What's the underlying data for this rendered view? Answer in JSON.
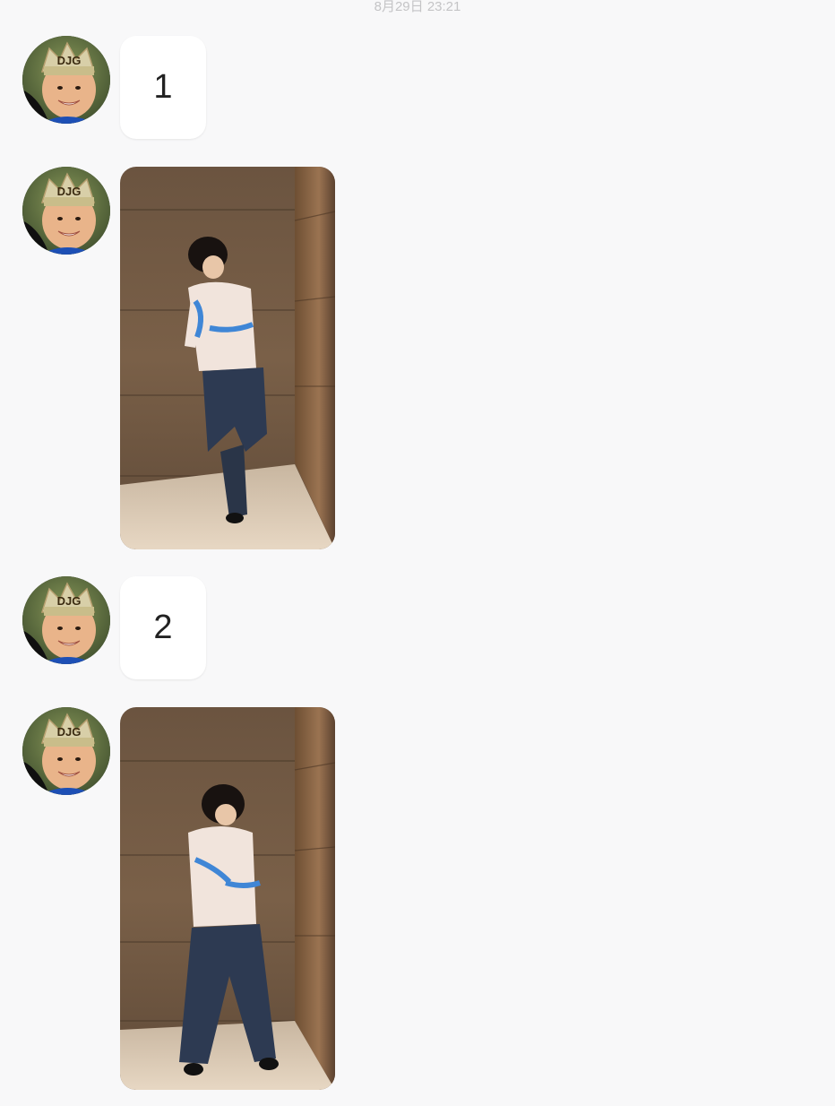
{
  "chat": {
    "timestamp": "8月29日 23:21",
    "messages": [
      {
        "type": "text",
        "text": "1"
      },
      {
        "type": "image",
        "image": "photo-person-leaning-wood-wall"
      },
      {
        "type": "text",
        "text": "2"
      },
      {
        "type": "image",
        "image": "photo-person-standing-wood-wall"
      }
    ],
    "sender_avatar": "avatar-child-smiling-with-crown"
  }
}
